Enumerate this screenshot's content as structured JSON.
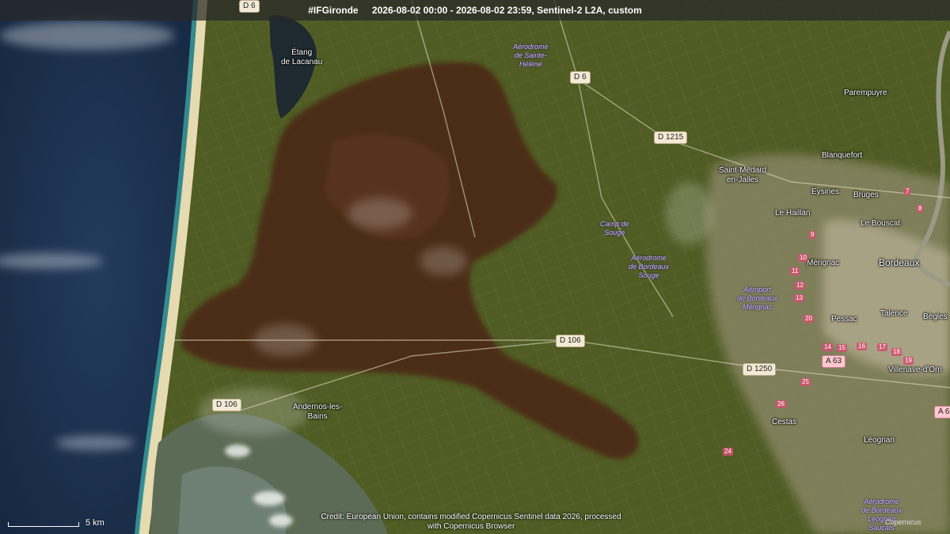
{
  "header": {
    "tag": "#IFGironde",
    "info": "2026-08-02 00:00 - 2026-08-02 23:59, Sentinel-2 L2A, custom"
  },
  "roads": [
    {
      "id": "d6-top",
      "label": "D 6"
    },
    {
      "id": "d6",
      "label": "D 6"
    },
    {
      "id": "d1215",
      "label": "D 1215"
    },
    {
      "id": "d106-center",
      "label": "D 106"
    },
    {
      "id": "d1250",
      "label": "D 1250"
    },
    {
      "id": "d106-west",
      "label": "D 106"
    },
    {
      "id": "a63",
      "label": "A 63"
    },
    {
      "id": "a6-edge",
      "label": "A 6"
    }
  ],
  "places": [
    {
      "id": "etang-lacanau",
      "label": "Étang\nde Lacanau"
    },
    {
      "id": "parempuyre",
      "label": "Parempuyre"
    },
    {
      "id": "blanquefort",
      "label": "Blanquefort"
    },
    {
      "id": "saint-medard",
      "label": "Saint-Médard\nen-Jalles"
    },
    {
      "id": "eysines",
      "label": "Eysines"
    },
    {
      "id": "bruges",
      "label": "Bruges"
    },
    {
      "id": "le-haillan",
      "label": "Le Haillan"
    },
    {
      "id": "le-bouscat",
      "label": "Le Bouscat"
    },
    {
      "id": "merignac",
      "label": "Mérignac"
    },
    {
      "id": "bordeaux",
      "label": "Bordeaux"
    },
    {
      "id": "pessac",
      "label": "Pessac"
    },
    {
      "id": "talence",
      "label": "Talence"
    },
    {
      "id": "begles",
      "label": "Bègles"
    },
    {
      "id": "villenave",
      "label": "Villenave-d'Orn"
    },
    {
      "id": "cestas",
      "label": "Cestas"
    },
    {
      "id": "leognan",
      "label": "Léognan"
    },
    {
      "id": "andernos",
      "label": "Andernos-les-\nBains"
    }
  ],
  "pois": [
    {
      "id": "aerodrome-sainte-helene",
      "label": "Aérodrome\nde Sainte-\nHélène"
    },
    {
      "id": "camp-de-souge",
      "label": "Camp de\nSouge"
    },
    {
      "id": "aerodrome-souge",
      "label": "Aérodrome\nde Bordeaux\nSouge"
    },
    {
      "id": "aeroport-merignac",
      "label": "Aéroport\nde Bordeaux\nMérignac"
    },
    {
      "id": "aerodrome-leognan",
      "label": "Aérodrome\nde Bordeaux\nLéognan\nSaucats"
    }
  ],
  "exit_numbers": [
    "7",
    "8",
    "9",
    "10",
    "11",
    "12",
    "13",
    "14",
    "15",
    "16",
    "17",
    "18",
    "19",
    "20",
    "24",
    "25",
    "26"
  ],
  "credit": "Credit: European Union, contains modified Copernicus Sentinel data 2026, processed with Copernicus Browser",
  "scale": {
    "label": "5 km"
  },
  "logo": "Copernicus",
  "colors": {
    "sea": "#1f3552",
    "land": "#4c5a22",
    "burn_scar": "#4a2a18",
    "beach": "#e8dcb3",
    "urban": "#a8a089"
  }
}
